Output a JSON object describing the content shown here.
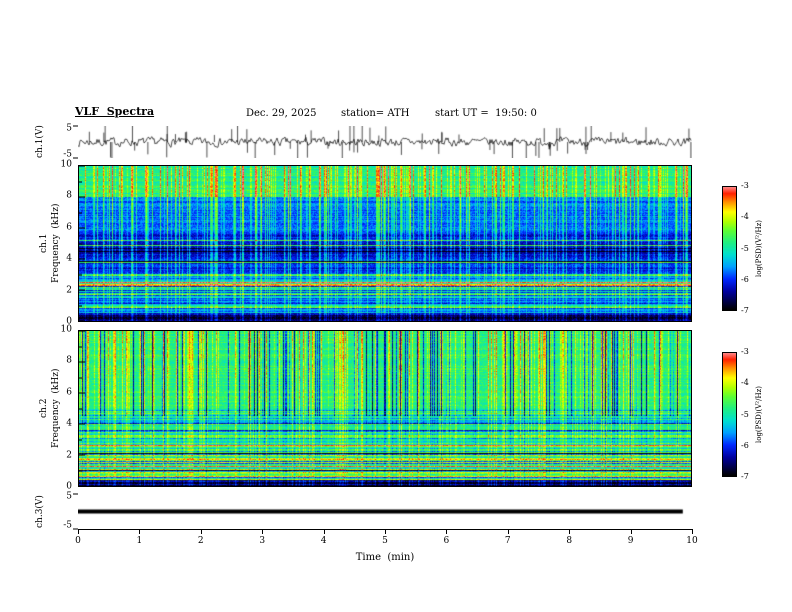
{
  "header": {
    "title": "VLF  Spectra",
    "date": "Dec. 29, 2025",
    "station": "station= ATH",
    "start_ut": "start UT =  19:50: 0"
  },
  "axes": {
    "time_label": "Time  (min)",
    "x_ticks": [
      "0",
      "1",
      "2",
      "3",
      "4",
      "5",
      "6",
      "7",
      "8",
      "9",
      "10"
    ],
    "freq_ticks": [
      "10",
      "8",
      "6",
      "4",
      "2",
      "0"
    ],
    "volt_top": "5",
    "volt_bottom": "-5"
  },
  "panels": {
    "wave1_label": "ch.1(V)",
    "spec1_ch": "ch.1",
    "spec1_freq": "Frequency  (kHz)",
    "spec2_ch": "ch.2",
    "spec2_freq": "Frequency  (kHz)",
    "wave3_label": "ch.3(V)"
  },
  "colorbar": {
    "label": "log(PSD)(V²/Hz)",
    "ticks": [
      "-3",
      "-4",
      "-5",
      "-6",
      "-7"
    ],
    "range": [
      -7,
      -3
    ]
  },
  "colormap": [
    [
      0.0,
      "#000000"
    ],
    [
      0.06,
      "#000040"
    ],
    [
      0.15,
      "#0000a0"
    ],
    [
      0.25,
      "#0028ff"
    ],
    [
      0.35,
      "#00a0ff"
    ],
    [
      0.45,
      "#00e0d0"
    ],
    [
      0.55,
      "#20f080"
    ],
    [
      0.65,
      "#60ff30"
    ],
    [
      0.72,
      "#b0ff00"
    ],
    [
      0.8,
      "#ffff00"
    ],
    [
      0.88,
      "#ff9000"
    ],
    [
      0.95,
      "#ff2000"
    ],
    [
      1.0,
      "#ff8080"
    ]
  ],
  "chart_data": [
    {
      "id": "wave_ch1",
      "type": "line",
      "panel": "ch.1(V)",
      "xlim": [
        0,
        10
      ],
      "ylim": [
        -5,
        5
      ],
      "x_units": "min",
      "y_units": "V",
      "summary": "Broadband noise waveform centered on 0 V, typical amplitude about ±1.5 V, with frequent impulsive spikes reaching toward ±5 V across the full 0–10 min record.",
      "render": {
        "seed": 7,
        "noise_amp": 1.0,
        "spike_count": 70
      }
    },
    {
      "id": "spec_ch1",
      "type": "heatmap",
      "panel": "ch.1",
      "ylabel": "Frequency (kHz)",
      "xlim": [
        0,
        10
      ],
      "ylim": [
        0,
        10
      ],
      "zlim": [
        -7,
        -3
      ],
      "zlabel": "log(PSD)(V²/Hz)",
      "summary": "VLF spectrogram ch.1: deep-blue background (~-6.5) from 3–8 kHz, green band (~-5) above 8 kHz, horizontally banded mixed levels (-6 to -4.5) below 3 kHz, near-black band (~-7) at 0 kHz, dense vertical sferic streaks reaching ~-4 spanning all frequencies.",
      "render": {
        "seed": 11,
        "streaks": {
          "p": 0.36,
          "min": 0.12,
          "max": 0.5,
          "dark_p": 0.0
        },
        "regions": [
          {
            "f0": 0.0,
            "f1": 0.035,
            "base": 0.06,
            "band": 0.05,
            "lines": false
          },
          {
            "f0": 0.035,
            "f1": 0.3,
            "base": 0.4,
            "band": 0.26,
            "lines": true
          },
          {
            "f0": 0.3,
            "f1": 0.56,
            "base": 0.2,
            "band": 0.07,
            "lines": true
          },
          {
            "f0": 0.56,
            "f1": 0.8,
            "base": 0.3,
            "band": 0.06,
            "lines": false
          },
          {
            "f0": 0.8,
            "f1": 1.01,
            "base": 0.54,
            "band": 0.07,
            "lines": false
          }
        ]
      }
    },
    {
      "id": "spec_ch2",
      "type": "heatmap",
      "panel": "ch.2",
      "ylabel": "Frequency (kHz)",
      "xlim": [
        0,
        10
      ],
      "ylim": [
        0,
        10
      ],
      "zlim": [
        -7,
        -3
      ],
      "zlabel": "log(PSD)(V²/Hz)",
      "summary": "VLF spectrogram ch.2: green background (~-5) above 5 kHz crossed by many bright yellow and dark blue vertical streaks, strong horizontal line structure (-6 to -3.5, including orange/red lines) below 5 kHz, near-black band at 0 kHz.",
      "render": {
        "seed": 23,
        "streaks": {
          "p": 0.3,
          "min": 0.08,
          "max": 0.38,
          "dark_p": 0.14
        },
        "regions": [
          {
            "f0": 0.0,
            "f1": 0.035,
            "base": 0.1,
            "band": 0.1,
            "lines": false
          },
          {
            "f0": 0.035,
            "f1": 0.22,
            "base": 0.55,
            "band": 0.3,
            "lines": true
          },
          {
            "f0": 0.22,
            "f1": 0.5,
            "base": 0.5,
            "band": 0.17,
            "lines": true
          },
          {
            "f0": 0.5,
            "f1": 1.01,
            "base": 0.56,
            "band": 0.05,
            "lines": false
          }
        ]
      }
    },
    {
      "id": "wave_ch3",
      "type": "line",
      "panel": "ch.3(V)",
      "xlim": [
        0,
        10
      ],
      "ylim": [
        -5,
        5
      ],
      "x_units": "min",
      "y_units": "V",
      "summary": "Constant 0 V signal drawn as a thick flat black line from 0 to ~9.85 min.",
      "render": {
        "thickness": 4,
        "extent": 0.985
      }
    }
  ]
}
